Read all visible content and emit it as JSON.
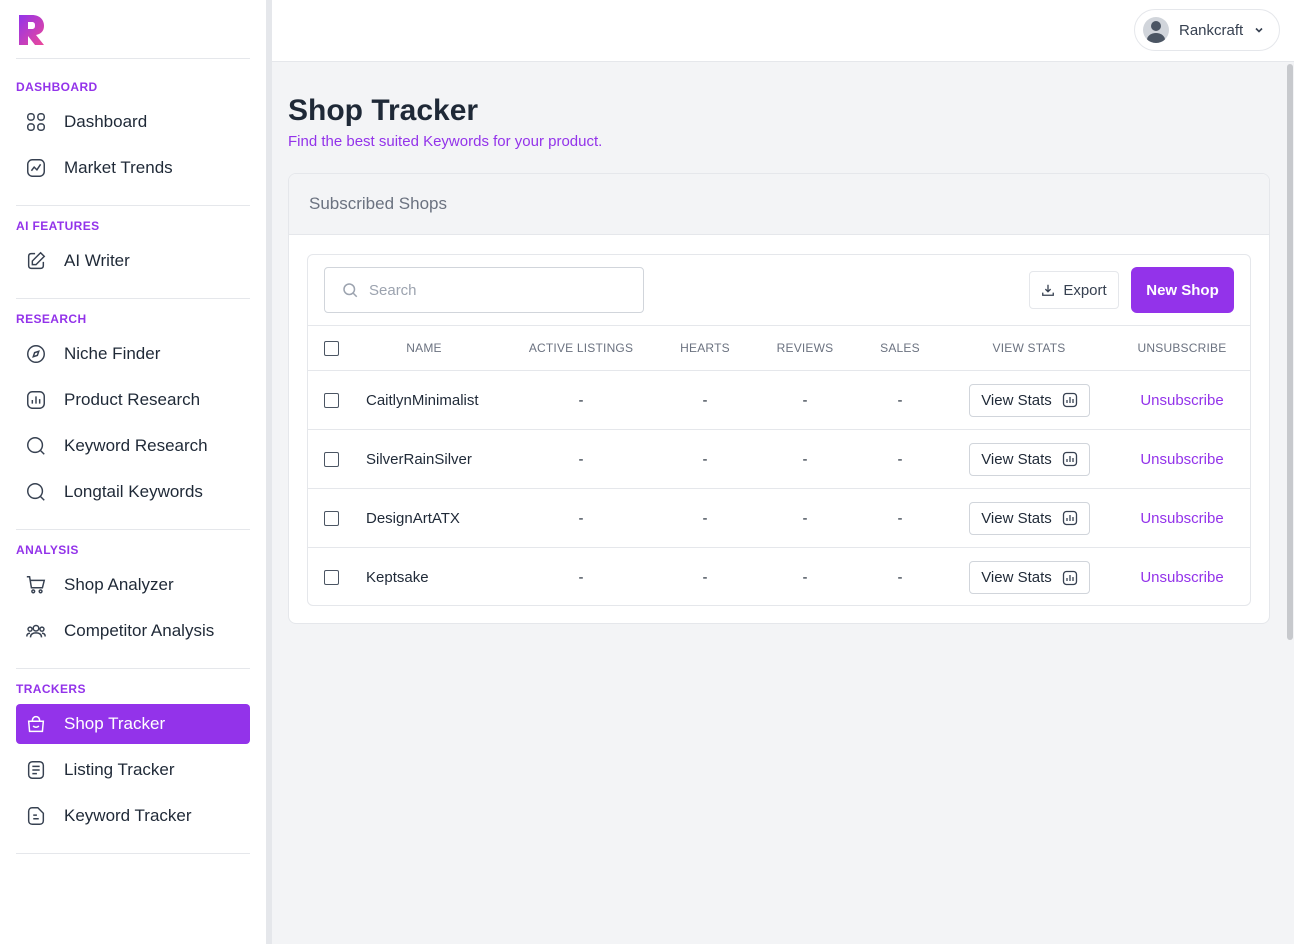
{
  "brand": {
    "accent": "#9333ea",
    "logo_icon": "rankcraft-logo-icon"
  },
  "user": {
    "name": "Rankcraft",
    "avatar_icon": "user-avatar-icon"
  },
  "sidebar": {
    "sections": [
      {
        "title": "DASHBOARD",
        "items": [
          {
            "label": "Dashboard",
            "icon": "grid-icon"
          },
          {
            "label": "Market Trends",
            "icon": "trend-chart-icon"
          }
        ]
      },
      {
        "title": "AI FEATURES",
        "items": [
          {
            "label": "AI Writer",
            "icon": "edit-icon"
          }
        ]
      },
      {
        "title": "RESEARCH",
        "items": [
          {
            "label": "Niche Finder",
            "icon": "compass-icon"
          },
          {
            "label": "Product Research",
            "icon": "bar-chart-icon"
          },
          {
            "label": "Keyword Research",
            "icon": "search-icon"
          },
          {
            "label": "Longtail Keywords",
            "icon": "search-icon"
          }
        ]
      },
      {
        "title": "ANALYSIS",
        "items": [
          {
            "label": "Shop Analyzer",
            "icon": "cart-icon"
          },
          {
            "label": "Competitor Analysis",
            "icon": "users-icon"
          }
        ]
      },
      {
        "title": "TRACKERS",
        "items": [
          {
            "label": "Shop Tracker",
            "icon": "shopping-bag-icon",
            "active": true
          },
          {
            "label": "Listing Tracker",
            "icon": "list-document-icon"
          },
          {
            "label": "Keyword Tracker",
            "icon": "file-text-icon"
          }
        ]
      }
    ]
  },
  "page": {
    "title": "Shop Tracker",
    "subtitle": "Find the best suited Keywords for your product."
  },
  "card": {
    "title": "Subscribed Shops",
    "search_placeholder": "Search",
    "export_label": "Export",
    "new_shop_label": "New Shop",
    "columns": [
      "NAME",
      "ACTIVE LISTINGS",
      "HEARTS",
      "REVIEWS",
      "SALES",
      "VIEW STATS",
      "UNSUBSCRIBE"
    ],
    "rows": [
      {
        "name": "CaitlynMinimalist",
        "active_listings": "-",
        "hearts": "-",
        "reviews": "-",
        "sales": "-",
        "view_stats": "View Stats",
        "unsubscribe": "Unsubscribe"
      },
      {
        "name": "SilverRainSilver",
        "active_listings": "-",
        "hearts": "-",
        "reviews": "-",
        "sales": "-",
        "view_stats": "View Stats",
        "unsubscribe": "Unsubscribe"
      },
      {
        "name": "DesignArtATX",
        "active_listings": "-",
        "hearts": "-",
        "reviews": "-",
        "sales": "-",
        "view_stats": "View Stats",
        "unsubscribe": "Unsubscribe"
      },
      {
        "name": "Keptsake",
        "active_listings": "-",
        "hearts": "-",
        "reviews": "-",
        "sales": "-",
        "view_stats": "View Stats",
        "unsubscribe": "Unsubscribe"
      }
    ]
  }
}
